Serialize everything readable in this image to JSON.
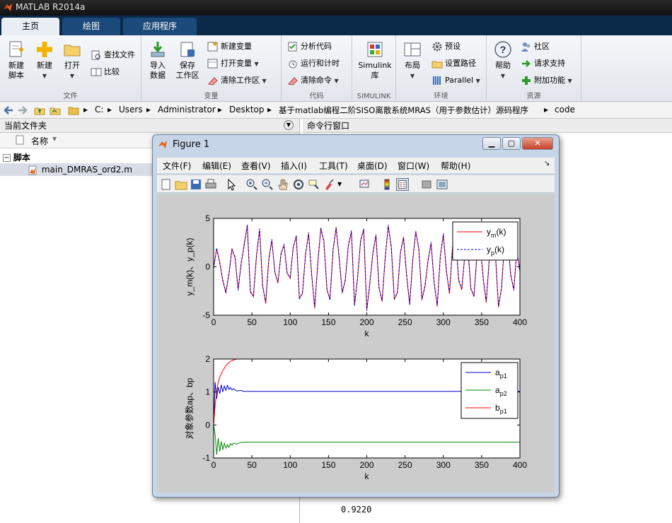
{
  "app": {
    "title": "MATLAB R2014a"
  },
  "tabs": [
    {
      "label": "主页",
      "active": true
    },
    {
      "label": "绘图",
      "active": false
    },
    {
      "label": "应用程序",
      "active": false
    }
  ],
  "ribbon": {
    "file": {
      "label": "文件",
      "new_script": [
        "新建",
        "脚本"
      ],
      "new": "新建",
      "open": "打开",
      "find_files": "查找文件",
      "compare": "比较"
    },
    "variable": {
      "label": "变量",
      "import": [
        "导入",
        "数据"
      ],
      "save_workspace": [
        "保存",
        "工作区"
      ],
      "new_variable": "新建变量",
      "open_variable": "打开变量",
      "clear_workspace": "清除工作区"
    },
    "code": {
      "label": "代码",
      "analyze": "分析代码",
      "run_time": "运行和计时",
      "clear_commands": "清除命令"
    },
    "simulink": {
      "label": "SIMULINK",
      "library": [
        "Simulink",
        "库"
      ]
    },
    "environment": {
      "label": "环境",
      "layout": "布局",
      "preferences": "预设",
      "set_path": "设置路径",
      "parallel": "Parallel"
    },
    "resources": {
      "label": "资源",
      "help": "帮助",
      "community": "社区",
      "request_support": "请求支持",
      "addons": "附加功能"
    }
  },
  "address": {
    "crumbs": [
      "C:",
      "Users",
      "Administrator",
      "Desktop",
      "基于matlab编程二阶SISO离散系统MRAS（用于参数估计）源码程序",
      "code"
    ]
  },
  "left_panel": {
    "title": "当前文件夹",
    "column": "名称",
    "group": "脚本",
    "file": "main_DMRAS_ord2.m"
  },
  "right_panel": {
    "title": "命令行窗口",
    "value": "0.9220"
  },
  "figure": {
    "title": "Figure 1",
    "menus": [
      "文件(F)",
      "编辑(E)",
      "查看(V)",
      "插入(I)",
      "工具(T)",
      "桌面(D)",
      "窗口(W)",
      "帮助(H)"
    ]
  },
  "chart_data": [
    {
      "type": "line",
      "ylabel": "y_m(k)、y_p(k)",
      "xlabel": "k",
      "xlim": [
        0,
        400
      ],
      "ylim": [
        -5,
        5
      ],
      "xticks": [
        0,
        50,
        100,
        150,
        200,
        250,
        300,
        350,
        400
      ],
      "yticks": [
        -5,
        0,
        5
      ],
      "legend_position": "top-right",
      "series": [
        {
          "name": "y_m(k)",
          "label_main": "y",
          "label_sub": "m",
          "label_tail": "(k)",
          "color": "#ff0000",
          "style": "solid"
        },
        {
          "name": "y_p(k)",
          "label_main": "y",
          "label_sub": "p",
          "label_tail": "(k)",
          "color": "#0000cc",
          "style": "dashed"
        }
      ],
      "samples": {
        "k_step": 4,
        "values": [
          0,
          1.8,
          0.5,
          -1.5,
          -2.6,
          -0.8,
          1.9,
          0.9,
          -2.3,
          0.3,
          2.4,
          4.2,
          -2.5,
          -3.1,
          1.2,
          3.8,
          -1.9,
          -3.8,
          0.8,
          2.7,
          -0.5,
          -1.7,
          1.4,
          2.2,
          -0.6,
          -1.2,
          2.1,
          3.1,
          -3.2,
          -2.8,
          1.3,
          3.4,
          -0.7,
          -4.3,
          0.4,
          3.9,
          2.7,
          -2.4,
          -3.3,
          1.7,
          4.1,
          0.8,
          -2.6,
          -1.4,
          2.3,
          3.6,
          -3.9,
          -1.2,
          2.8,
          3.8,
          -4.4,
          -1.8,
          1.5,
          3.2,
          -2.1,
          -3.6,
          0.9,
          4.2,
          2.1,
          -3.4,
          -2.6,
          1.4,
          3.1,
          -0.9,
          -3.8,
          0.6,
          3.7,
          1.8,
          -3.3,
          -2.1,
          0.7,
          2.4,
          -1.6,
          -4.1,
          1.1,
          3.3,
          -0.4,
          -2.8,
          2.1,
          3.2,
          -1.3,
          -2.4,
          1.2,
          1.9,
          -2.2,
          -3.1,
          1.4,
          2.4,
          -1.1,
          -3.7,
          0.9,
          3.4,
          1.4,
          -4.2,
          -2.1,
          2.6,
          3.1,
          -0.9,
          -2.3,
          1.6,
          -0.4
        ]
      }
    },
    {
      "type": "line",
      "ylabel": "对象参数ap、bp",
      "xlabel": "k",
      "xlim": [
        0,
        400
      ],
      "ylim": [
        -1,
        2
      ],
      "xticks": [
        0,
        50,
        100,
        150,
        200,
        250,
        300,
        350,
        400
      ],
      "yticks": [
        -1,
        0,
        1,
        2
      ],
      "legend_position": "top-right",
      "series": [
        {
          "name": "a_p1",
          "label_main": "a",
          "label_sub": "p1",
          "label_tail": "",
          "color": "#0000cc",
          "x": [
            0,
            2,
            4,
            6,
            8,
            10,
            12,
            14,
            16,
            18,
            20,
            22,
            24,
            26,
            30,
            35,
            40,
            50,
            400
          ],
          "y": [
            0,
            1.3,
            0.8,
            1.15,
            0.95,
            1.22,
            1.0,
            1.18,
            1.05,
            1.2,
            1.08,
            1.14,
            1.06,
            1.1,
            1.03,
            1.05,
            1.02,
            1.02,
            1.02
          ]
        },
        {
          "name": "a_p2",
          "label_main": "a",
          "label_sub": "p2",
          "label_tail": "",
          "color": "#008800",
          "x": [
            0,
            2,
            4,
            6,
            8,
            10,
            12,
            14,
            16,
            18,
            20,
            22,
            24,
            26,
            30,
            35,
            40,
            50,
            400
          ],
          "y": [
            0,
            -0.3,
            -0.9,
            -0.4,
            -0.8,
            -0.5,
            -0.75,
            -0.55,
            -0.7,
            -0.6,
            -0.68,
            -0.56,
            -0.62,
            -0.55,
            -0.58,
            -0.53,
            -0.52,
            -0.52,
            -0.52
          ]
        },
        {
          "name": "b_p1",
          "label_main": "b",
          "label_sub": "p1",
          "label_tail": "",
          "color": "#ff0000",
          "x": [
            0,
            2,
            4,
            6,
            8,
            10,
            12,
            14,
            16,
            18,
            20,
            22,
            24,
            26,
            28,
            30,
            35,
            40,
            400
          ],
          "y": [
            0,
            0.6,
            1.0,
            1.3,
            1.45,
            1.55,
            1.65,
            1.72,
            1.8,
            1.86,
            1.9,
            1.93,
            1.95,
            1.97,
            1.98,
            2.0,
            2.0,
            2.0,
            2.0
          ]
        }
      ]
    }
  ]
}
